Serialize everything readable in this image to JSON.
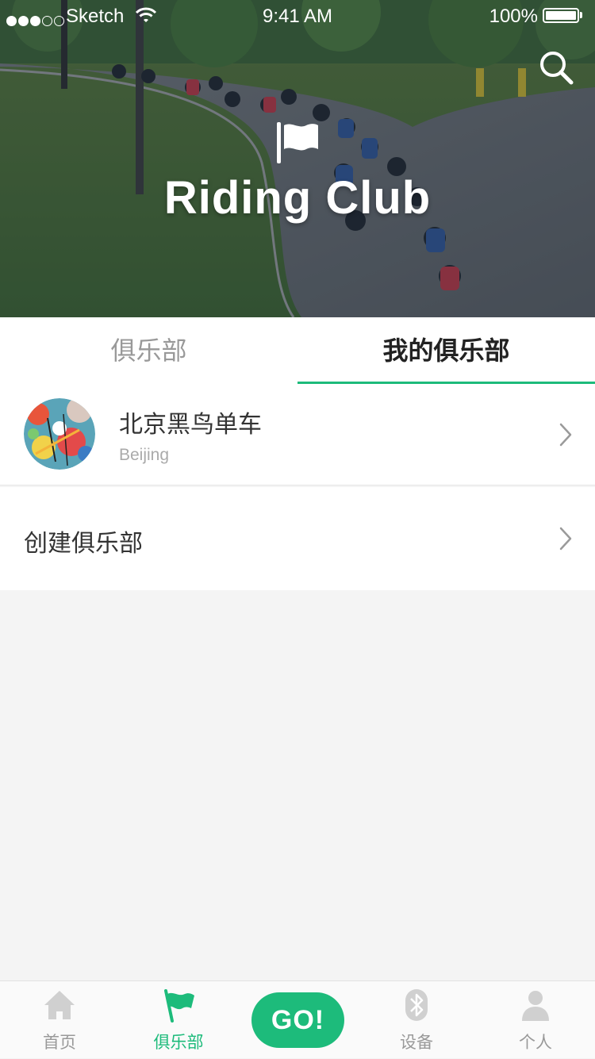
{
  "status_bar": {
    "carrier": "Sketch",
    "time": "9:41 AM",
    "battery": "100%",
    "signal_bars_filled": 3,
    "signal_bars_total": 5
  },
  "hero": {
    "title": "Riding Club",
    "flag_icon": "flag-icon",
    "search_icon": "search-icon"
  },
  "tabs": [
    {
      "label": "俱乐部",
      "active": false
    },
    {
      "label": "我的俱乐部",
      "active": true
    }
  ],
  "clubs": [
    {
      "name": "北京黑鸟单车",
      "city": "Beijing"
    }
  ],
  "create_club": {
    "label": "创建俱乐部"
  },
  "tabbar": {
    "items": [
      {
        "label": "首页",
        "icon": "home-icon",
        "active": false
      },
      {
        "label": "俱乐部",
        "icon": "flag-icon",
        "active": true
      },
      {
        "label": "设备",
        "icon": "bluetooth-icon",
        "active": false
      },
      {
        "label": "个人",
        "icon": "person-icon",
        "active": false
      }
    ],
    "go_label": "GO!"
  },
  "colors": {
    "accent": "#1dbb7b",
    "background": "#f4f4f4",
    "inactive_text": "#999999"
  }
}
